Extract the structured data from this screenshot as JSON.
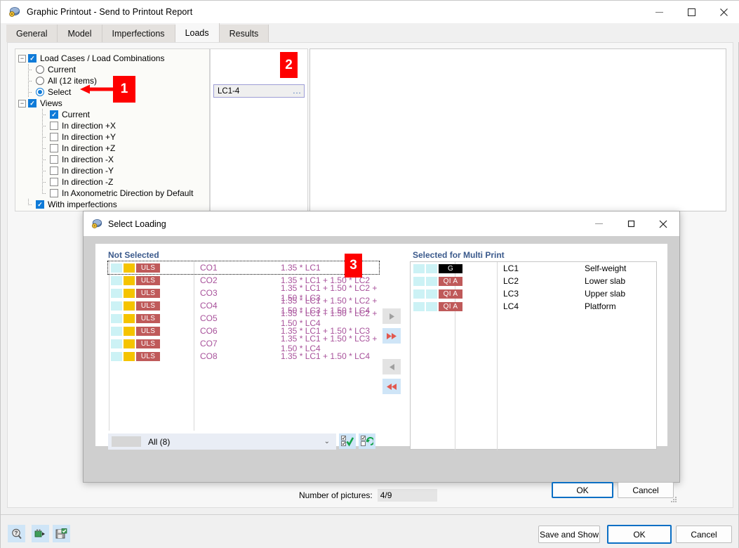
{
  "window": {
    "title": "Graphic Printout - Send to Printout Report",
    "icon": "printout-app-icon",
    "controls": {
      "minimize": "–",
      "maximize": "□",
      "close": "✕"
    }
  },
  "tabs": [
    {
      "label": "General",
      "active": false
    },
    {
      "label": "Model",
      "active": false
    },
    {
      "label": "Imperfections",
      "active": false
    },
    {
      "label": "Loads",
      "active": true
    },
    {
      "label": "Results",
      "active": false
    }
  ],
  "tree": {
    "root": {
      "label": "Load Cases / Load Combinations",
      "checked": true,
      "expanded": true
    },
    "load_options": [
      {
        "label": "Current",
        "selected": false
      },
      {
        "label": "All (12 items)",
        "selected": false
      },
      {
        "label": "Select",
        "selected": true
      }
    ],
    "views": {
      "label": "Views",
      "checked": true,
      "expanded": true
    },
    "view_items": [
      {
        "label": "Current",
        "checked": true
      },
      {
        "label": "In direction +X",
        "checked": false
      },
      {
        "label": "In direction +Y",
        "checked": false
      },
      {
        "label": "In direction +Z",
        "checked": false
      },
      {
        "label": "In direction -X",
        "checked": false
      },
      {
        "label": "In direction -Y",
        "checked": false
      },
      {
        "label": "In direction -Z",
        "checked": false
      },
      {
        "label": "In Axonometric Direction by Default",
        "checked": false
      }
    ],
    "with_imperfections": {
      "label": "With imperfections",
      "checked": true
    }
  },
  "selection_field": {
    "value": "LC1-4",
    "ellipsis": "...",
    "name": "load-selection-field"
  },
  "markers": [
    {
      "id": "1",
      "text": "1"
    },
    {
      "id": "2",
      "text": "2"
    },
    {
      "id": "3",
      "text": "3"
    }
  ],
  "number_of_pictures": {
    "label": "Number of pictures:",
    "value": "4/9"
  },
  "bottom_toolbar": [
    {
      "name": "help-icon",
      "glyph": "?"
    },
    {
      "name": "settings-plug-icon",
      "glyph": "▶"
    },
    {
      "name": "save-settings-icon",
      "glyph": "💾"
    }
  ],
  "bottom_buttons": {
    "save_and_show": "Save and Show",
    "ok": "OK",
    "cancel": "Cancel"
  },
  "dialog": {
    "title": "Select Loading",
    "icon": "printout-app-icon",
    "controls": {
      "minimize": "–",
      "maximize": "□",
      "close": "✕"
    },
    "not_selected": {
      "header": "Not Selected",
      "rows": [
        {
          "category": "ULS",
          "id": "CO1",
          "formula": "1.35 * LC1",
          "focused": true
        },
        {
          "category": "ULS",
          "id": "CO2",
          "formula": "1.35 * LC1 + 1.50 * LC2",
          "focused": false
        },
        {
          "category": "ULS",
          "id": "CO3",
          "formula": "1.35 * LC1 + 1.50 * LC2 + 1.50 * LC3",
          "focused": false
        },
        {
          "category": "ULS",
          "id": "CO4",
          "formula": "1.35 * LC1 + 1.50 * LC2 + 1.50 * LC3 + 1.50 * LC4",
          "focused": false
        },
        {
          "category": "ULS",
          "id": "CO5",
          "formula": "1.35 * LC1 + 1.50 * LC2 + 1.50 * LC4",
          "focused": false
        },
        {
          "category": "ULS",
          "id": "CO6",
          "formula": "1.35 * LC1 + 1.50 * LC3",
          "focused": false
        },
        {
          "category": "ULS",
          "id": "CO7",
          "formula": "1.35 * LC1 + 1.50 * LC3 + 1.50 * LC4",
          "focused": false
        },
        {
          "category": "ULS",
          "id": "CO8",
          "formula": "1.35 * LC1 + 1.50 * LC4",
          "focused": false
        }
      ]
    },
    "selected": {
      "header": "Selected for Multi Print",
      "rows": [
        {
          "category": "G",
          "category_style": "black",
          "id": "LC1",
          "description": "Self-weight"
        },
        {
          "category": "QI A",
          "category_style": "red",
          "id": "LC2",
          "description": "Lower slab"
        },
        {
          "category": "QI A",
          "category_style": "red",
          "id": "LC3",
          "description": "Upper slab"
        },
        {
          "category": "QI A",
          "category_style": "red",
          "id": "LC4",
          "description": "Platform"
        }
      ]
    },
    "transfer_buttons": [
      {
        "name": "move-right-button",
        "glyph": "▶",
        "style": "grey"
      },
      {
        "name": "move-all-right-button",
        "glyph": "▶▶",
        "style": "blue"
      },
      {
        "name": "move-left-button",
        "glyph": "◀",
        "style": "grey"
      },
      {
        "name": "move-all-left-button",
        "glyph": "◀◀",
        "style": "blue"
      }
    ],
    "filter": {
      "value": "All (8)",
      "chevron": "⌄"
    },
    "filter_buttons": [
      {
        "name": "select-all-button",
        "glyph": "✔"
      },
      {
        "name": "invert-selection-button",
        "glyph": "⇄"
      }
    ],
    "buttons": {
      "ok": "OK",
      "cancel": "Cancel"
    }
  },
  "colors": {
    "accent": "#0f7bd8",
    "marker_red": "#fe0000",
    "category_red": "#bf5a5a",
    "formula_purple": "#a8529b",
    "header_blue": "#3b5a8c",
    "swatch_cyan": "#ccf2f5",
    "swatch_yellow": "#f5c400"
  }
}
